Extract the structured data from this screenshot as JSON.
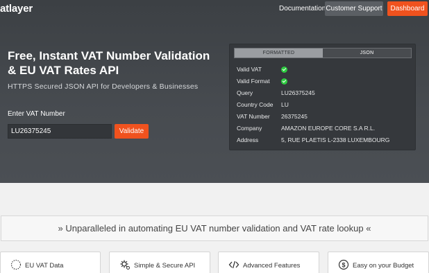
{
  "header": {
    "logo": "atlayer",
    "nav": {
      "documentation": "Documentation",
      "support": "Customer Support",
      "dashboard": "Dashboard"
    }
  },
  "hero": {
    "title": "Free, Instant VAT Number Validation & EU VAT Rates API",
    "subtitle": "HTTPS Secured JSON API for Developers & Businesses",
    "input_label": "Enter VAT Number",
    "input_value": "LU26375245",
    "validate_label": "Validate"
  },
  "result_panel": {
    "tabs": [
      "FORMATTED",
      "JSON"
    ],
    "active_tab": "FORMATTED",
    "rows": [
      {
        "key": "Valid VAT",
        "value": "",
        "check": true
      },
      {
        "key": "Valid Format",
        "value": "",
        "check": true
      },
      {
        "key": "Query",
        "value": "LU26375245"
      },
      {
        "key": "Country Code",
        "value": "LU"
      },
      {
        "key": "VAT Number",
        "value": "26375245"
      },
      {
        "key": "Company",
        "value": "AMAZON EUROPE CORE S.A R.L."
      },
      {
        "key": "Address",
        "value": "5, RUE PLAETIS L-2338 LUXEMBOURG"
      }
    ],
    "colors": {
      "check": "#2ecc40"
    }
  },
  "banner": {
    "text": "» Unparalleled in automating EU VAT number validation and VAT rate lookup «"
  },
  "features": [
    {
      "label": "EU VAT Data",
      "icon": "globe-dotted-icon"
    },
    {
      "label": "Simple & Secure API",
      "icon": "gear-icon"
    },
    {
      "label": "Advanced Features",
      "icon": "code-icon"
    },
    {
      "label": "Easy on your Budget",
      "icon": "dollar-icon"
    }
  ],
  "colors": {
    "accent": "#f0521e",
    "hero_bg": "#43474b"
  }
}
